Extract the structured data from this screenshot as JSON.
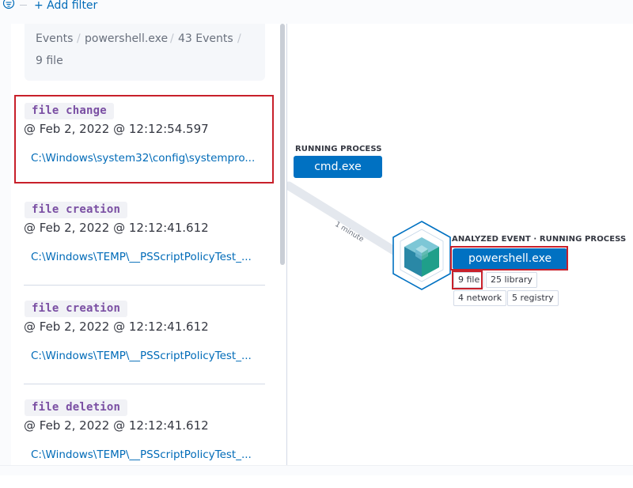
{
  "filter_bar": {
    "add_filter_label": "+ Add filter"
  },
  "breadcrumb": {
    "items": [
      "Events",
      "powershell.exe",
      "43 Events",
      "9 file"
    ],
    "separator": "/"
  },
  "events": [
    {
      "type": "file change",
      "timestamp": "@ Feb 2, 2022 @ 12:12:54.597",
      "path": "C:\\Windows\\system32\\config\\systempro..."
    },
    {
      "type": "file creation",
      "timestamp": "@ Feb 2, 2022 @ 12:12:41.612",
      "path": "C:\\Windows\\TEMP\\__PSScriptPolicyTest_..."
    },
    {
      "type": "file creation",
      "timestamp": "@ Feb 2, 2022 @ 12:12:41.612",
      "path": "C:\\Windows\\TEMP\\__PSScriptPolicyTest_..."
    },
    {
      "type": "file deletion",
      "timestamp": "@ Feb 2, 2022 @ 12:12:41.612",
      "path": "C:\\Windows\\TEMP\\__PSScriptPolicyTest_..."
    }
  ],
  "graph": {
    "parent_node": {
      "label": "RUNNING PROCESS",
      "name": "cmd.exe"
    },
    "edge_label": "1 minute",
    "analyzed_node": {
      "label": "ANALYZED EVENT · RUNNING PROCESS",
      "name": "powershell.exe",
      "icon": "cube-icon",
      "counts": [
        "9 file",
        "25 library",
        "4 network",
        "5 registry"
      ]
    }
  },
  "colors": {
    "link": "#006bb8",
    "process_button": "#0071c2",
    "tag_text": "#7a4fa3",
    "highlight": "#c8202a"
  }
}
